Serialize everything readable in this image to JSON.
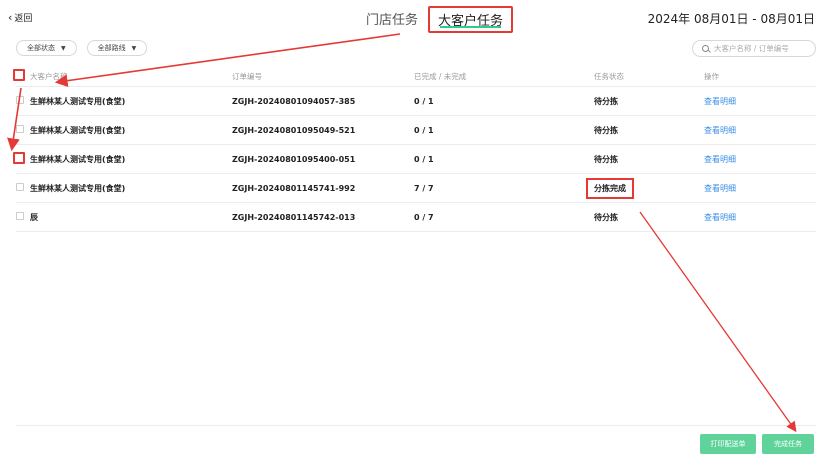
{
  "header": {
    "back_label": "返回",
    "tabs": [
      {
        "label": "门店任务",
        "active": false
      },
      {
        "label": "大客户任务",
        "active": true
      }
    ],
    "date_range": "2024年 08月01日 - 08月01日"
  },
  "filters": {
    "status": "全部状态",
    "route": "全部路线"
  },
  "search": {
    "placeholder": "大客户名称 / 订单编号"
  },
  "table": {
    "headers": [
      "大客户名称",
      "订单编号",
      "已完成 / 未完成",
      "任务状态",
      "操作"
    ],
    "rows": [
      {
        "name": "生鲜林某人测试专用(食堂)",
        "order": "ZGJH-20240801094057-385",
        "progress": "0 / 1",
        "status": "待分拣",
        "action": "查看明细"
      },
      {
        "name": "生鲜林某人测试专用(食堂)",
        "order": "ZGJH-20240801095049-521",
        "progress": "0 / 1",
        "status": "待分拣",
        "action": "查看明细"
      },
      {
        "name": "生鲜林某人测试专用(食堂)",
        "order": "ZGJH-20240801095400-051",
        "progress": "0 / 1",
        "status": "待分拣",
        "action": "查看明细"
      },
      {
        "name": "生鲜林某人测试专用(食堂)",
        "order": "ZGJH-20240801145741-992",
        "progress": "7 / 7",
        "status": "分拣完成",
        "action": "查看明细"
      },
      {
        "name": "辰",
        "order": "ZGJH-20240801145742-013",
        "progress": "0 / 7",
        "status": "待分拣",
        "action": "查看明细"
      }
    ]
  },
  "buttons": {
    "print": "打印配送单",
    "finish": "完成任务"
  },
  "colors": {
    "accent_green": "#5fd39a",
    "annotation_red": "#e53935",
    "link_blue": "#3a8ee6"
  }
}
